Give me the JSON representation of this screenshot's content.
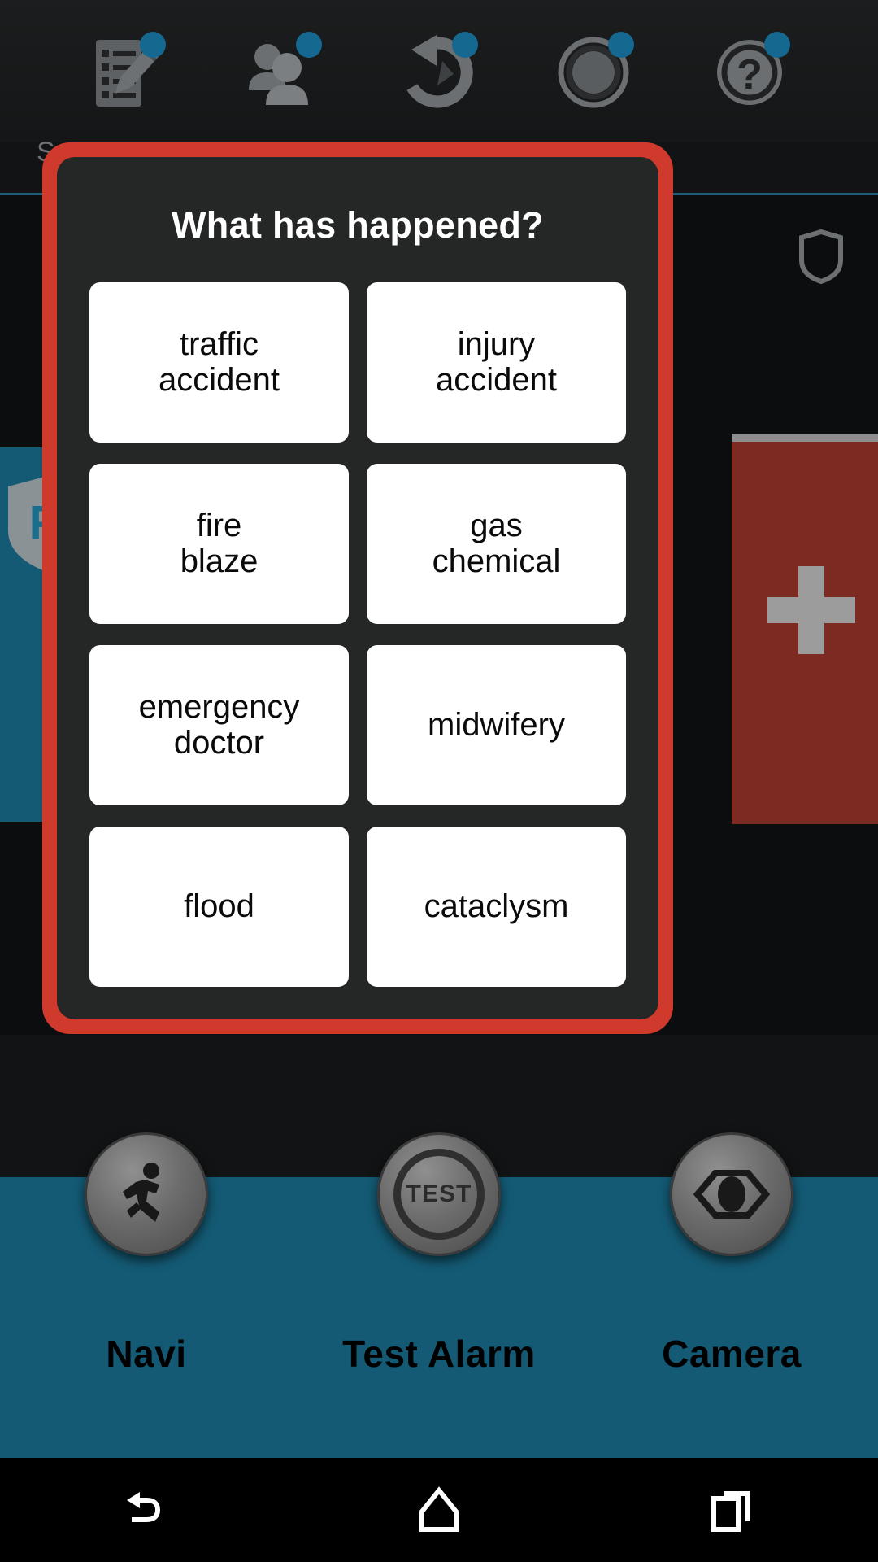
{
  "background": {
    "toolbar": {
      "items": [
        {
          "icon": "checklist-edit-icon",
          "badge": true
        },
        {
          "icon": "contacts-group-icon",
          "badge": true
        },
        {
          "icon": "history-rotate-icon",
          "badge": true
        },
        {
          "icon": "siren-ring-icon",
          "badge": true
        },
        {
          "icon": "help-question-icon",
          "badge": true
        }
      ]
    },
    "section_label": "Sc",
    "tiles": [
      {
        "name": "police-shield-tile",
        "glyph": "P",
        "color": "#145a74"
      },
      {
        "name": "medical-cross-tile",
        "glyph": "+",
        "color": "#7d2a22"
      }
    ],
    "bottom_nav": [
      {
        "label": "Navi",
        "icon": "running-person-icon"
      },
      {
        "label": "Test Alarm",
        "icon": "test-button-icon",
        "knob_text": "TEST"
      },
      {
        "label": "Camera",
        "icon": "eye-camera-icon"
      }
    ]
  },
  "dialog": {
    "title": "What has happened?",
    "border_color": "#cf3a2c",
    "surface_color": "#252626",
    "choices": [
      {
        "id": "traffic-accident",
        "label": "traffic\naccident"
      },
      {
        "id": "injury-accident",
        "label": "injury\naccident"
      },
      {
        "id": "fire-blaze",
        "label": "fire\nblaze"
      },
      {
        "id": "gas-chemical",
        "label": "gas\nchemical"
      },
      {
        "id": "emergency-doctor",
        "label": "emergency doctor"
      },
      {
        "id": "midwifery",
        "label": "midwifery"
      },
      {
        "id": "flood",
        "label": "flood"
      },
      {
        "id": "cataclysm",
        "label": "cataclysm"
      }
    ]
  },
  "system_nav": {
    "buttons": [
      {
        "name": "back-button",
        "icon": "back-arrow-icon"
      },
      {
        "name": "home-button",
        "icon": "home-icon"
      },
      {
        "name": "recents-button",
        "icon": "recents-icon"
      }
    ]
  }
}
